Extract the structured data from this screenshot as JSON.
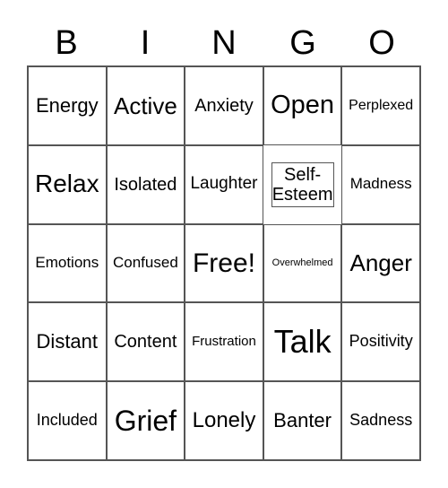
{
  "header": [
    "B",
    "I",
    "N",
    "G",
    "O"
  ],
  "cells": [
    "Energy",
    "Active",
    "Anxiety",
    "Open",
    "Perplexed",
    "Relax",
    "Isolated",
    "Laughter",
    "Self-Esteem",
    "Madness",
    "Emotions",
    "Confused",
    "Free!",
    "Overwhelmed",
    "Anger",
    "Distant",
    "Content",
    "Frustration",
    "Talk",
    "Positivity",
    "Included",
    "Grief",
    "Lonely",
    "Banter",
    "Sadness"
  ]
}
